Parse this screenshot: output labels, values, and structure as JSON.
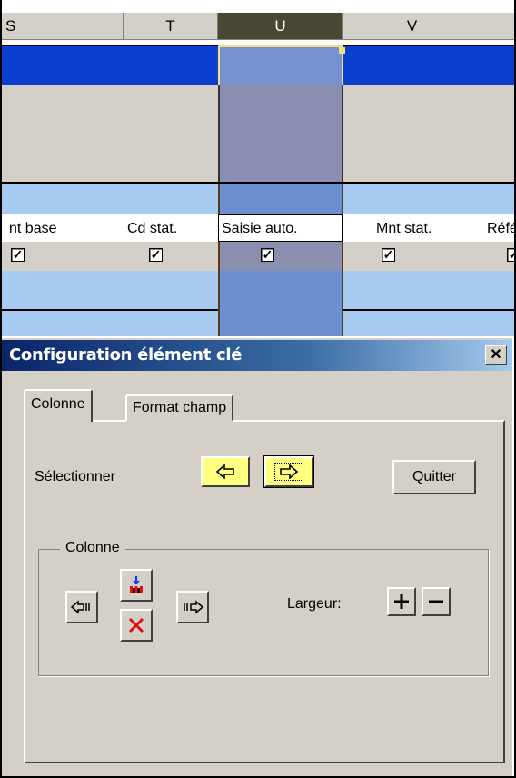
{
  "sheet": {
    "columns": [
      "S",
      "T",
      "U",
      "V",
      ""
    ],
    "field_labels": [
      "nt base",
      "Cd stat.",
      "Saisie auto.",
      "Mnt stat.",
      "Réfé"
    ],
    "checkboxes": [
      true,
      true,
      true,
      true,
      true
    ],
    "colors": {
      "header_selected": "#474733",
      "row_dark_blue": "#0a3fcf",
      "row_light_blue": "#a6caf0",
      "row_gray": "#d4d0c8",
      "selected_column": "#6b84c4"
    }
  },
  "dialog": {
    "title": "Configuration élément clé",
    "close_label": "✕",
    "tabs": [
      {
        "label": "Colonne",
        "active": true
      },
      {
        "label": "Format champ",
        "active": false
      }
    ],
    "select_label": "Sélectionner",
    "quit_label": "Quitter",
    "group_legend": "Colonne",
    "width_label": "Largeur:",
    "icons": {
      "prev": "arrow-left-icon",
      "next": "arrow-right-icon",
      "move_left": "move-left-icon",
      "move_right": "move-right-icon",
      "insert": "insert-column-icon",
      "delete": "delete-x-icon",
      "plus": "plus-icon",
      "minus": "minus-icon"
    }
  }
}
